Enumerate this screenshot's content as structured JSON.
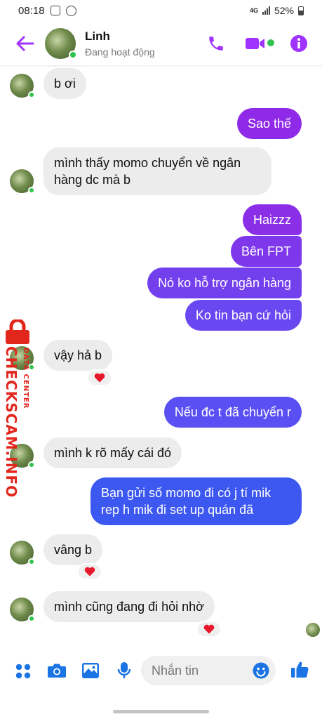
{
  "status_bar": {
    "time": "08:18",
    "network": "4G",
    "battery": "52%"
  },
  "header": {
    "contact_name": "Linh",
    "contact_status": "Đang hoạt động"
  },
  "messages": [
    {
      "id": 1,
      "direction": "in",
      "text": "b ơi"
    },
    {
      "id": 2,
      "direction": "out",
      "text": "Sao thế"
    },
    {
      "id": 3,
      "direction": "in",
      "text": "mình thấy momo chuyển về ngân\nhàng dc mà b"
    },
    {
      "id": 4,
      "direction": "out",
      "text": "Haizzz"
    },
    {
      "id": 5,
      "direction": "out",
      "text": "Bên FPT"
    },
    {
      "id": 6,
      "direction": "out",
      "text": "Nó ko hỗ trợ ngân hàng"
    },
    {
      "id": 7,
      "direction": "out",
      "text": "Ko tin bạn cứ hỏi"
    },
    {
      "id": 8,
      "direction": "in",
      "text": "vậy hả b",
      "reaction": "heart"
    },
    {
      "id": 9,
      "direction": "out",
      "text": "Nếu đc t đã chuyển r"
    },
    {
      "id": 10,
      "direction": "in",
      "text": "mình k rõ mấy cái đó"
    },
    {
      "id": 11,
      "direction": "out",
      "text": "Bạn gửi số momo đi có j tí mik\nrep h mik đi set up quán đã"
    },
    {
      "id": 12,
      "direction": "in",
      "text": "vâng b",
      "reaction": "heart"
    },
    {
      "id": 13,
      "direction": "in",
      "text": "mình cũng đang đi hỏi nhờ",
      "reaction": "heart"
    }
  ],
  "watermark": {
    "text": "CHECKSCAM.INFO",
    "subtext": "DATA CENTER"
  },
  "composer": {
    "placeholder": "Nhắn tin"
  },
  "colors": {
    "accent": "#a033ff",
    "bubble_purple": "#8a2be2",
    "bubble_blue": "#4a4cf0",
    "incoming_bubble": "#ececec",
    "online": "#31c24d",
    "composer_icons": "#1b74e4",
    "watermark": "#e1261c"
  },
  "icons": [
    "back-arrow-icon",
    "phone-icon",
    "video-camera-icon",
    "info-icon",
    "apps-icon",
    "camera-icon",
    "image-icon",
    "microphone-icon",
    "emoji-icon",
    "thumbs-up-icon",
    "heart-icon",
    "lock-icon"
  ]
}
